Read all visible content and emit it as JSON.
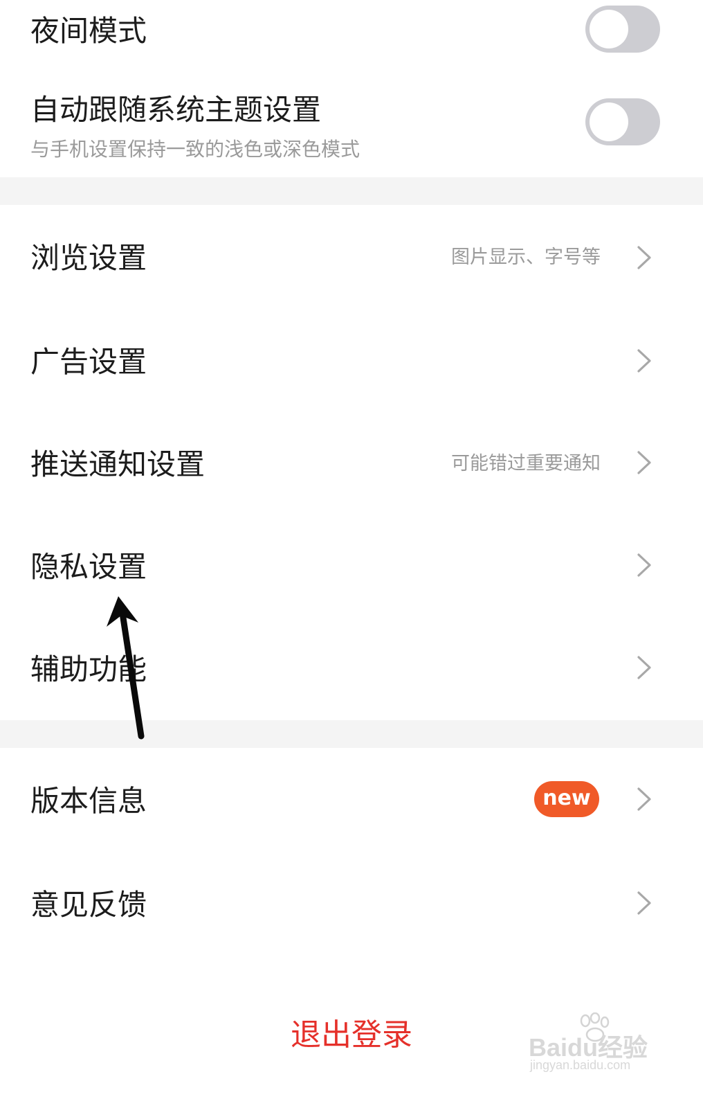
{
  "display": {
    "night_mode": {
      "label": "夜间模式",
      "enabled": false
    },
    "follow_system": {
      "label": "自动跟随系统主题设置",
      "description": "与手机设置保持一致的浅色或深色模式",
      "enabled": false
    }
  },
  "settings": {
    "browse": {
      "label": "浏览设置",
      "hint": "图片显示、字号等"
    },
    "ads": {
      "label": "广告设置"
    },
    "push": {
      "label": "推送通知设置",
      "hint": "可能错过重要通知"
    },
    "privacy": {
      "label": "隐私设置"
    },
    "accessibility": {
      "label": "辅助功能"
    }
  },
  "about": {
    "version": {
      "label": "版本信息",
      "badge": "new"
    },
    "feedback": {
      "label": "意见反馈"
    }
  },
  "logout_label": "退出登录",
  "watermark": {
    "brand": "Baidu经验",
    "url": "jingyan.baidu.com"
  },
  "colors": {
    "logout": "#e5302a",
    "badge": "#f05a28",
    "toggle_off": "#cdcdd2",
    "section_gap": "#f4f4f4"
  }
}
